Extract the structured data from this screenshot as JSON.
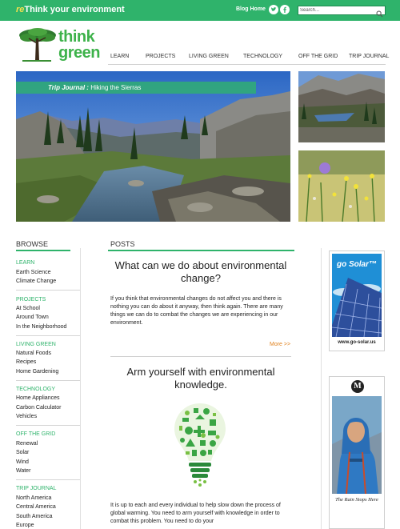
{
  "header": {
    "tagline_prefix": "re",
    "tagline_rest": "Think your environment",
    "blog_home": "Blog Home",
    "search_placeholder": "Search...",
    "accent_color": "#2fb36b"
  },
  "logo": {
    "line1": "think",
    "line2": "green"
  },
  "nav": {
    "items": [
      "LEARN",
      "PROJECTS",
      "LIVING GREEN",
      "TECHNOLOGY",
      "OFF THE GRID",
      "TRIP JOURNAL"
    ]
  },
  "hero": {
    "caption_label": "Trip Journal :",
    "caption_title": "Hiking the Sierras"
  },
  "browse": {
    "title": "BROWSE",
    "sections": [
      {
        "heading": "LEARN",
        "items": [
          "Earth Science",
          "Climate Change"
        ]
      },
      {
        "heading": "PROJECTS",
        "items": [
          "At School",
          "Around Town",
          "In the Neighborhood"
        ]
      },
      {
        "heading": "LIVING GREEN",
        "items": [
          "Natural Foods",
          "Recipes",
          "Home Gardening"
        ]
      },
      {
        "heading": "TECHNOLOGY",
        "items": [
          "Home Appliances",
          "Carbon Calculator",
          "Vehicles"
        ]
      },
      {
        "heading": "OFF THE GRID",
        "items": [
          "Renewal",
          "Solar",
          "Wind",
          "Water"
        ]
      },
      {
        "heading": "TRIP JOURNAL",
        "items": [
          "North America",
          "Central America",
          "South America",
          "Europe"
        ]
      }
    ]
  },
  "posts": {
    "title": "POSTS",
    "post1": {
      "heading": "What can we do about environmental change?",
      "body": "If you think that environmental changes do not affect you and there is nothing you can do about it anyway, then think again. There are many things we can do to combat the changes we are experiencing in our environment.",
      "more": "More >>"
    },
    "post2": {
      "heading": "Arm yourself with environmental knowledge.",
      "body": "It is up to each and every individual to help slow down the process of global warming. You need to arm yourself with knowledge in order to combat this problem. You need to do your"
    }
  },
  "ads": {
    "solar_title": "go Solar™",
    "solar_url": "www.go-solar.us",
    "book_logo": "M",
    "book_title": "The Rain Stops Here"
  }
}
